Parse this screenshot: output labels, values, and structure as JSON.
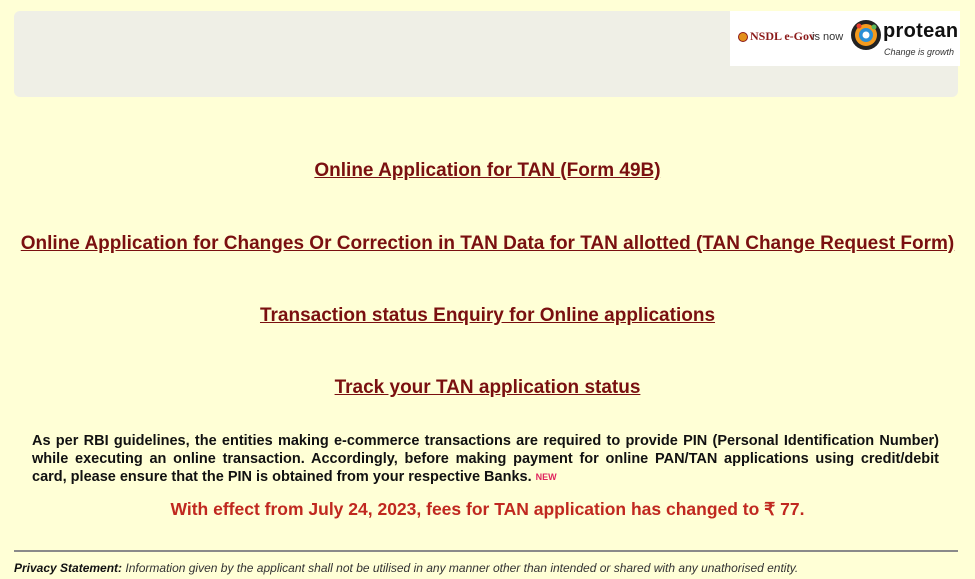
{
  "header": {
    "nsdl_text": "NSDL e-Gov",
    "is_now_text": "is now",
    "brand_name": "protean",
    "brand_tagline": "Change is growth"
  },
  "links": [
    "Online Application for TAN (Form 49B)",
    "Online Application for Changes Or Correction in TAN Data for TAN allotted (TAN Change Request Form)",
    "Transaction status Enquiry for Online applications",
    "Track your TAN application status"
  ],
  "notice": {
    "text": "As per RBI guidelines, the entities making e-commerce transactions are required to provide PIN (Personal Identification Number) while executing an online transaction. Accordingly, before making payment for online PAN/TAN applications using credit/debit card, please ensure that the PIN is obtained from your respective Banks.",
    "badge": "NEW"
  },
  "fee_notice": "With effect from July 24, 2023, fees for TAN application has changed to ₹ 77.",
  "privacy": {
    "label": "Privacy Statement:",
    "text": "Information given by the applicant shall not be utilised in any manner other than intended or shared with any unathorised entity."
  },
  "colors": {
    "background": "#ffffd6",
    "link": "#7a1010",
    "fee": "#c0281f"
  }
}
